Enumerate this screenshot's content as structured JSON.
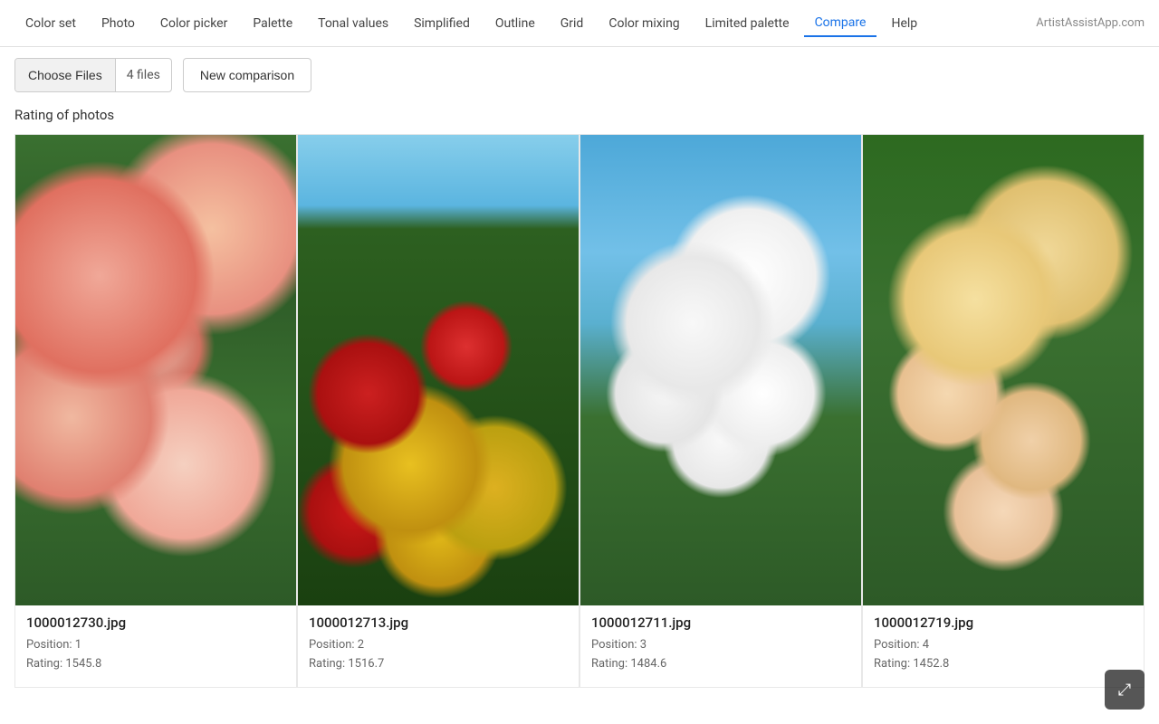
{
  "nav": {
    "items": [
      {
        "label": "Color set",
        "id": "color-set",
        "active": false
      },
      {
        "label": "Photo",
        "id": "photo",
        "active": false
      },
      {
        "label": "Color picker",
        "id": "color-picker",
        "active": false
      },
      {
        "label": "Palette",
        "id": "palette",
        "active": false
      },
      {
        "label": "Tonal values",
        "id": "tonal-values",
        "active": false
      },
      {
        "label": "Simplified",
        "id": "simplified",
        "active": false
      },
      {
        "label": "Outline",
        "id": "outline",
        "active": false
      },
      {
        "label": "Grid",
        "id": "grid",
        "active": false
      },
      {
        "label": "Color mixing",
        "id": "color-mixing",
        "active": false
      },
      {
        "label": "Limited palette",
        "id": "limited-palette",
        "active": false
      },
      {
        "label": "Compare",
        "id": "compare",
        "active": true
      },
      {
        "label": "Help",
        "id": "help",
        "active": false
      }
    ],
    "logo_text": "ArtistAssistApp.com"
  },
  "toolbar": {
    "choose_files_label": "Choose Files",
    "file_count": "4 files",
    "new_comparison_label": "New comparison"
  },
  "section": {
    "title": "Rating of photos"
  },
  "photos": [
    {
      "filename": "1000012730.jpg",
      "position": "Position: 1",
      "rating": "Rating: 1545.8",
      "image_class": "photo-image-1"
    },
    {
      "filename": "1000012713.jpg",
      "position": "Position: 2",
      "rating": "Rating: 1516.7",
      "image_class": "photo-image-2"
    },
    {
      "filename": "1000012711.jpg",
      "position": "Position: 3",
      "rating": "Rating: 1484.6",
      "image_class": "photo-image-3"
    },
    {
      "filename": "1000012719.jpg",
      "position": "Position: 4",
      "rating": "Rating: 1452.8",
      "image_class": "photo-image-4"
    }
  ],
  "fullscreen": {
    "icon": "⤢"
  }
}
